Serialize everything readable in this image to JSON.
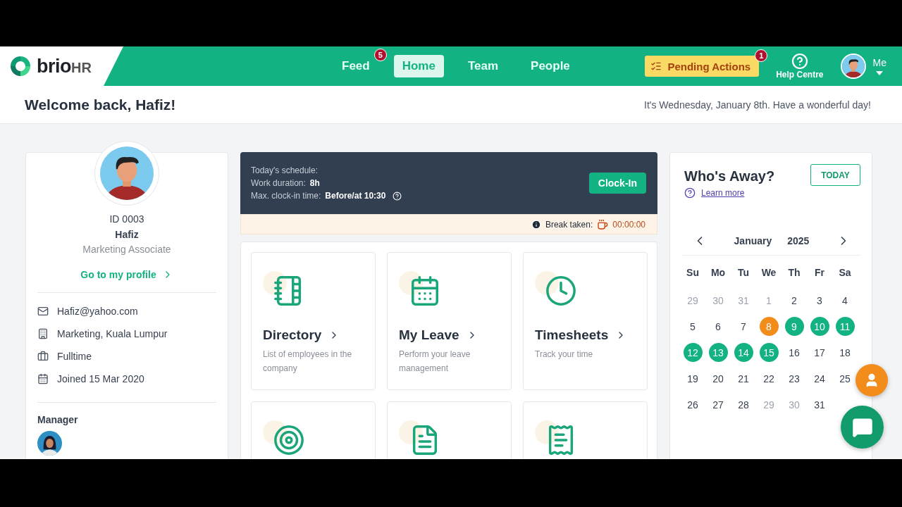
{
  "header": {
    "logo": {
      "word": "brio",
      "suffix": "HR"
    },
    "nav": [
      {
        "label": "Feed",
        "selected": false,
        "badge": "5"
      },
      {
        "label": "Home",
        "selected": true
      },
      {
        "label": "Team",
        "selected": false
      },
      {
        "label": "People",
        "selected": false
      }
    ],
    "pending_actions": {
      "label": "Pending Actions",
      "badge": "1"
    },
    "help": {
      "label": "Help Centre"
    },
    "user": {
      "label": "Me"
    }
  },
  "welcome": {
    "title": "Welcome back, Hafiz!",
    "message": "It's Wednesday, January 8th. Have a wonderful day!"
  },
  "profile": {
    "id": "ID 0003",
    "name": "Hafiz",
    "role": "Marketing Associate",
    "link": "Go to my profile",
    "details": [
      {
        "kind": "email",
        "text": "Hafiz@yahoo.com"
      },
      {
        "kind": "office",
        "text": "Marketing, Kuala Lumpur"
      },
      {
        "kind": "employment",
        "text": "Fulltime"
      },
      {
        "kind": "joined",
        "text": "Joined 15 Mar 2020"
      }
    ],
    "manager_label": "Manager"
  },
  "schedule": {
    "title": "Today's schedule:",
    "duration_label": "Work duration:",
    "duration": "8h",
    "max_label": "Max. clock-in time:",
    "max_value": "Before/at 10:30",
    "button": "Clock-In",
    "break_label": "Break taken:",
    "break_time": "00:00:00"
  },
  "shortcuts": [
    {
      "kind": "directory",
      "title": "Directory",
      "description": "List of employees in the company"
    },
    {
      "kind": "leave",
      "title": "My Leave",
      "description": "Perform your leave management"
    },
    {
      "kind": "timesheets",
      "title": "Timesheets",
      "description": "Track your time"
    },
    {
      "kind": "goals"
    },
    {
      "kind": "payslip"
    },
    {
      "kind": "expenses"
    }
  ],
  "whos_away": {
    "title": "Who's Away?",
    "learn_more": "Learn more",
    "today_button": "TODAY",
    "month": "January",
    "year": "2025",
    "weekdays": [
      "Su",
      "Mo",
      "Tu",
      "We",
      "Th",
      "Fr",
      "Sa"
    ],
    "days": [
      {
        "label": "29",
        "kind": "other"
      },
      {
        "label": "30",
        "kind": "other"
      },
      {
        "label": "31",
        "kind": "other"
      },
      {
        "label": "1",
        "kind": "other"
      },
      {
        "label": "2",
        "kind": "normal"
      },
      {
        "label": "3",
        "kind": "normal"
      },
      {
        "label": "4",
        "kind": "normal"
      },
      {
        "label": "5",
        "kind": "normal"
      },
      {
        "label": "6",
        "kind": "normal"
      },
      {
        "label": "7",
        "kind": "normal"
      },
      {
        "label": "8",
        "kind": "today"
      },
      {
        "label": "9",
        "kind": "away"
      },
      {
        "label": "10",
        "kind": "away"
      },
      {
        "label": "11",
        "kind": "away"
      },
      {
        "label": "12",
        "kind": "away"
      },
      {
        "label": "13",
        "kind": "away"
      },
      {
        "label": "14",
        "kind": "away"
      },
      {
        "label": "15",
        "kind": "away"
      },
      {
        "label": "16",
        "kind": "normal"
      },
      {
        "label": "17",
        "kind": "normal"
      },
      {
        "label": "18",
        "kind": "normal"
      },
      {
        "label": "19",
        "kind": "normal"
      },
      {
        "label": "20",
        "kind": "normal"
      },
      {
        "label": "21",
        "kind": "normal"
      },
      {
        "label": "22",
        "kind": "normal"
      },
      {
        "label": "23",
        "kind": "normal"
      },
      {
        "label": "24",
        "kind": "normal"
      },
      {
        "label": "25",
        "kind": "normal"
      },
      {
        "label": "26",
        "kind": "normal"
      },
      {
        "label": "27",
        "kind": "normal"
      },
      {
        "label": "28",
        "kind": "normal"
      },
      {
        "label": "29",
        "kind": "other"
      },
      {
        "label": "30",
        "kind": "other"
      },
      {
        "label": "31",
        "kind": "normal"
      }
    ]
  }
}
